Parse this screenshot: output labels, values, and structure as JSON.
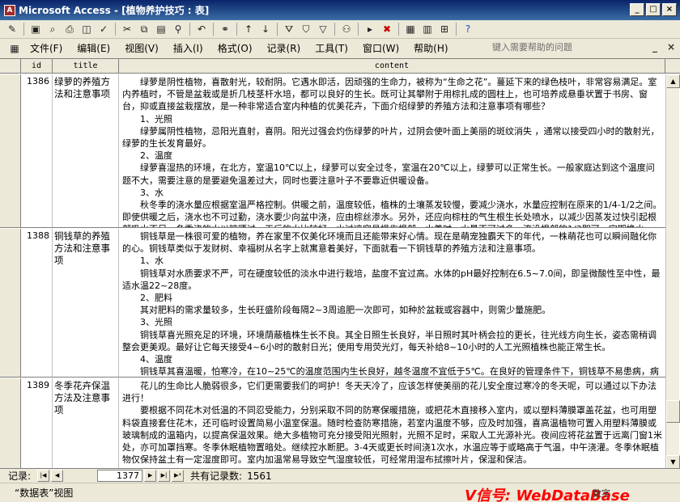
{
  "window": {
    "title": "Microsoft Access - [植物养护技巧 : 表]",
    "controls": [
      "_",
      "□",
      "×"
    ]
  },
  "toolbar": {
    "icons": [
      "design-view-icon",
      "save-icon",
      "file-search-icon",
      "print-icon",
      "print-preview-icon",
      "spelling-icon",
      "cut-icon",
      "copy-icon",
      "paste-icon",
      "format-painter-icon",
      "undo-icon",
      "insert-hyperlink-icon",
      "sort-ascending-icon",
      "sort-descending-icon",
      "filter-by-selection-icon",
      "filter-by-form-icon",
      "apply-filter-icon",
      "find-icon",
      "new-record-icon",
      "delete-record-icon",
      "properties-icon",
      "database-window-icon",
      "new-object-icon",
      "help-icon"
    ]
  },
  "menu": {
    "items": [
      "文件(F)",
      "编辑(E)",
      "视图(V)",
      "插入(I)",
      "格式(O)",
      "记录(R)",
      "工具(T)",
      "窗口(W)",
      "帮助(H)"
    ],
    "ask_placeholder": "键入需要帮助的问题",
    "mdi_controls": [
      "_",
      "×"
    ]
  },
  "table": {
    "columns": [
      "id",
      "title",
      "content"
    ],
    "rows": [
      {
        "id": "1386",
        "title": "绿萝的养殖方法和注意事项",
        "content": [
          "绿萝是阴性植物，喜散射光，较耐阴。它遇水即活，因顽强的生命力，被称为“生命之花”。蔓延下来的绿色枝叶，非常容易满足。室内养植时，不管是盆栽或是折几枝茎杆水培，都可以良好的生长。既可让其攀附于用棕扎成的圆柱上，也可培养成悬垂状置于书房、窗台，抑或直接盆栽摆放，是一种非常适合室内种植的优美花卉，下面介绍绿萝的养殖方法和注意事项有哪些？",
          "1、光照",
          "绿萝属阴性植物，忌阳光直射，喜阴。阳光过强会灼伤绿萝的叶片，过阴会使叶面上美丽的斑纹消失 ，通常以接受四小时的散射光，绿萝的生长发育最好。",
          "2、温度",
          "绿萝喜湿热的环境，在北方，室温10℃以上，绿萝可以安全过冬，室温在20℃以上，绿萝可以正常生长。一般家庭达到这个温度问题不大，需要注意的是要避免温差过大，同时也要注意叶子不要靠近供暖设备。",
          "3、水",
          "秋冬季的浇水量应根据室温严格控制。供暖之前，温度较低，植株的土壤蒸发较慢，要减少浇水，水量应控制在原来的1/4-1/2之间。即使供暖之后，浇水也不可过勤，浇水要少向盆中浇，应由棕丝渗水。另外，还应向棕柱的气生根生长处喷水，以减少因蒸发过快引起根部吸水不足。冬季浇的水以晾晒过一天后的水比较好，水过凉容易损伤根部。水养时，水量不可过多，淹没根部的1/3即可，定期换水。"
        ]
      },
      {
        "id": "1388",
        "title": "铜钱草的养殖方法和注意事项",
        "content": [
          "铜钱草是一株很可爱的植物，养在家里不仅美化环境而且还能带来好心情。现在是萌宠独霸天下的年代，一株萌花也可以瞬间融化你的心。铜钱草类似于发财树、幸福树从名字上就寓意着美好，下面就看一下铜钱草的养殖方法和注意事项。",
          "1、水",
          "铜钱草对水质要求不严，可在硬度较低的淡水中进行栽培，盐度不宜过高。水体的pH最好控制在6.5~7.0间，即呈微酸性至中性，最适水温22~28度。",
          "2、肥料",
          "其对肥料的需求量较多，生长旺盛阶段每隔2~3周追肥一次即可，如种於盆栽或容器中，则需少量施肥。",
          "3、光照",
          "铜钱草喜光照充足的环境，环境荫蔽植株生长不良。其全日照生长良好，半日照时其叶柄会拉的更长，往光线方向生长，姿态需稍调整会更美观。最好让它每天接受4~6小时的散射日光；使用专用荧光灯，每天补给8~10小时的人工光照植株也能正常生长。",
          "4、温度",
          "铜钱草其喜温暖，怕寒冷，在10~25℃的温度范围内生长良好，越冬温度不宜低于5℃。在良好的管理条件下，铜钱草不易患病，病害也很多对它造成的伤害。"
        ]
      },
      {
        "id": "1389",
        "title": "冬季花卉保温方法及注意事项",
        "content": [
          "花儿的生命比人脆弱很多，它们更需要我们的呵护！冬天天冷了，应该怎样使美丽的花儿安全度过寒冷的冬天呢，可以通过以下办法进行！",
          "要根据不同花木对低温的不同忍受能力，分别采取不同的防寒保暖措施，或把花木直接移入室内，或以塑料薄膜罩盖花盆，也可用塑料袋直接套住花木，还可临时设置简易小温室保温。随时检查防寒措施，若室内温度不够，应及时加强，喜高温植物可置入用塑料薄膜或玻璃制成的温箱内，以提高保温效果。绝大多植物可充分接受阳光照射，光照不足时，采取人工光源补光。夜间应将花盆置于远离门窗1米处，亦可加罩挡寒。冬季休眠植物置暗处。继续控水断肥。3-4天或更长时间浇1次水，水温应等于或略高于气温，中午浇灌。冬季休眠植物仅保持盆土有一定湿度即可。室内加温常易导致空气湿度较低，可经常用湿布拭擦叶片，保湿和保洁。"
        ]
      }
    ]
  },
  "navigation": {
    "label": "记录:",
    "current": "1377",
    "total_label": "共有记录数:",
    "total": "1561"
  },
  "status": {
    "view": "“数据表”视图",
    "watermark": "V信号: WebDataBase",
    "indicator": "数字"
  }
}
